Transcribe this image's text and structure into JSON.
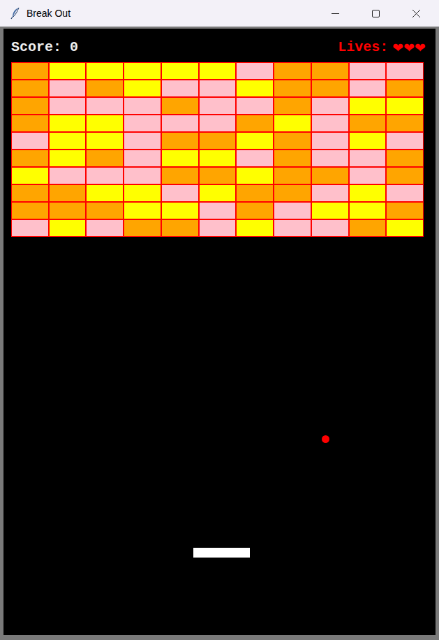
{
  "window": {
    "title": "Break Out"
  },
  "score": "Score: 0",
  "lives": {
    "label": "Lives:",
    "hearts": [
      "❤",
      "❤",
      "❤"
    ]
  },
  "bricks": [
    [
      {
        "color": "#ffa500"
      },
      {
        "color": "#ffff00"
      },
      {
        "color": "#ffff00"
      },
      {
        "color": "#ffff00"
      },
      {
        "color": "#ffff00"
      },
      {
        "color": "#ffff00"
      },
      {
        "color": "#ffc0cb"
      },
      {
        "color": "#ffa500"
      },
      {
        "color": "#ffa500"
      },
      {
        "color": "#ffc0cb"
      },
      {
        "color": "#ffc0cb"
      }
    ],
    [
      {
        "color": "#ffa500"
      },
      {
        "color": "#ffc0cb"
      },
      {
        "color": "#ffa500"
      },
      {
        "color": "#ffff00"
      },
      {
        "color": "#ffc0cb"
      },
      {
        "color": "#ffc0cb"
      },
      {
        "color": "#ffff00"
      },
      {
        "color": "#ffa500"
      },
      {
        "color": "#ffa500"
      },
      {
        "color": "#ffc0cb"
      },
      {
        "color": "#ffa500"
      }
    ],
    [
      {
        "color": "#ffa500"
      },
      {
        "color": "#ffc0cb"
      },
      {
        "color": "#ffc0cb"
      },
      {
        "color": "#ffc0cb"
      },
      {
        "color": "#ffa500"
      },
      {
        "color": "#ffc0cb"
      },
      {
        "color": "#ffc0cb"
      },
      {
        "color": "#ffa500"
      },
      {
        "color": "#ffc0cb"
      },
      {
        "color": "#ffff00"
      },
      {
        "color": "#ffff00"
      }
    ],
    [
      {
        "color": "#ffa500"
      },
      {
        "color": "#ffff00"
      },
      {
        "color": "#ffff00"
      },
      {
        "color": "#ffc0cb"
      },
      {
        "color": "#ffc0cb"
      },
      {
        "color": "#ffc0cb"
      },
      {
        "color": "#ffa500"
      },
      {
        "color": "#ffff00"
      },
      {
        "color": "#ffc0cb"
      },
      {
        "color": "#ffa500"
      },
      {
        "color": "#ffa500"
      }
    ],
    [
      {
        "color": "#ffc0cb"
      },
      {
        "color": "#ffff00"
      },
      {
        "color": "#ffff00"
      },
      {
        "color": "#ffc0cb"
      },
      {
        "color": "#ffa500"
      },
      {
        "color": "#ffa500"
      },
      {
        "color": "#ffff00"
      },
      {
        "color": "#ffa500"
      },
      {
        "color": "#ffc0cb"
      },
      {
        "color": "#ffff00"
      },
      {
        "color": "#ffc0cb"
      }
    ],
    [
      {
        "color": "#ffa500"
      },
      {
        "color": "#ffff00"
      },
      {
        "color": "#ffa500"
      },
      {
        "color": "#ffc0cb"
      },
      {
        "color": "#ffff00"
      },
      {
        "color": "#ffff00"
      },
      {
        "color": "#ffc0cb"
      },
      {
        "color": "#ffa500"
      },
      {
        "color": "#ffc0cb"
      },
      {
        "color": "#ffc0cb"
      },
      {
        "color": "#ffa500"
      }
    ],
    [
      {
        "color": "#ffff00"
      },
      {
        "color": "#ffc0cb"
      },
      {
        "color": "#ffc0cb"
      },
      {
        "color": "#ffc0cb"
      },
      {
        "color": "#ffa500"
      },
      {
        "color": "#ffa500"
      },
      {
        "color": "#ffff00"
      },
      {
        "color": "#ffa500"
      },
      {
        "color": "#ffa500"
      },
      {
        "color": "#ffc0cb"
      },
      {
        "color": "#ffa500"
      }
    ],
    [
      {
        "color": "#ffa500"
      },
      {
        "color": "#ffa500"
      },
      {
        "color": "#ffff00"
      },
      {
        "color": "#ffff00"
      },
      {
        "color": "#ffc0cb"
      },
      {
        "color": "#ffff00"
      },
      {
        "color": "#ffa500"
      },
      {
        "color": "#ffa500"
      },
      {
        "color": "#ffc0cb"
      },
      {
        "color": "#ffff00"
      },
      {
        "color": "#ffc0cb"
      }
    ],
    [
      {
        "color": "#ffa500"
      },
      {
        "color": "#ffa500"
      },
      {
        "color": "#ffa500"
      },
      {
        "color": "#ffff00"
      },
      {
        "color": "#ffff00"
      },
      {
        "color": "#ffc0cb"
      },
      {
        "color": "#ffa500"
      },
      {
        "color": "#ffc0cb"
      },
      {
        "color": "#ffff00"
      },
      {
        "color": "#ffff00"
      },
      {
        "color": "#ffa500"
      }
    ],
    [
      {
        "color": "#ffc0cb"
      },
      {
        "color": "#ffff00"
      },
      {
        "color": "#ffc0cb"
      },
      {
        "color": "#ffa500"
      },
      {
        "color": "#ffa500"
      },
      {
        "color": "#ffc0cb"
      },
      {
        "color": "#ffff00"
      },
      {
        "color": "#ffc0cb"
      },
      {
        "color": "#ffc0cb"
      },
      {
        "color": "#ffa500"
      },
      {
        "color": "#ffff00"
      }
    ]
  ]
}
